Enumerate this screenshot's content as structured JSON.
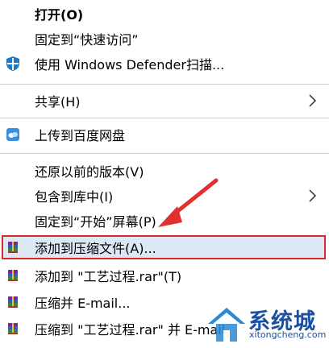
{
  "menu": {
    "open": "打开(O)",
    "pin_quick_access": "固定到“快速访问”",
    "defender_scan": "使用 Windows Defender扫描...",
    "share": "共享(H)",
    "upload_baidu": "上传到百度网盘",
    "restore_previous": "还原以前的版本(V)",
    "include_library": "包含到库中(I)",
    "pin_start": "固定到“开始”屏幕(P)",
    "add_to_archive": "添加到压缩文件(A)...",
    "add_to_rar": "添加到 \"工艺过程.rar\"(T)",
    "compress_email": "压缩并 E-mail...",
    "compress_rar_email": "压缩到 \"工艺过程.rar\" 并 E-mail"
  },
  "watermark": {
    "brand": "系统城",
    "url": "xitongcheng.com"
  },
  "colors": {
    "highlight_border": "#d92b2b",
    "highlight_fill": "#dde8f5",
    "separator": "#cfcfcf",
    "arrow": "#e03030",
    "watermark": "#1b4fa0"
  }
}
